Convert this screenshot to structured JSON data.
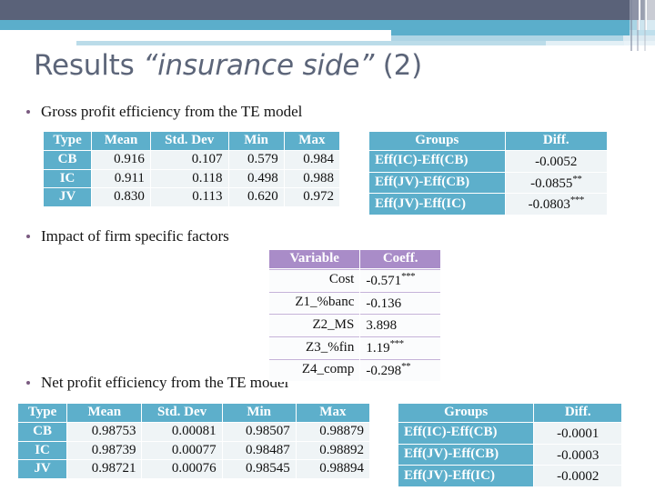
{
  "slide": {
    "title_plain_1": "Results ",
    "title_italic": "“insurance side”",
    "title_plain_2": " (2)",
    "accent_teal": "#5DAFCB",
    "accent_purple": "#A98CC8",
    "title_color": "#5C6579",
    "header_dark": "#5A6279"
  },
  "bullets": {
    "b1": "Gross profit efficiency from the TE model",
    "b2": "Impact of firm specific factors",
    "b3": "Net profit efficiency from the TE model"
  },
  "table_gross_stats": {
    "headers": [
      "Type",
      "Mean",
      "Std. Dev",
      "Min",
      "Max"
    ],
    "rows": [
      {
        "type": "CB",
        "mean": "0.916",
        "sd": "0.107",
        "min": "0.579",
        "max": "0.984"
      },
      {
        "type": "IC",
        "mean": "0.911",
        "sd": "0.118",
        "min": "0.498",
        "max": "0.988"
      },
      {
        "type": "JV",
        "mean": "0.830",
        "sd": "0.113",
        "min": "0.620",
        "max": "0.972"
      }
    ]
  },
  "table_gross_diff": {
    "headers": [
      "Groups",
      "Diff."
    ],
    "rows": [
      {
        "group": "Eff(IC)-Eff(CB)",
        "diff": "-0.0052",
        "stars": ""
      },
      {
        "group": "Eff(JV)-Eff(CB)",
        "diff": "-0.0855",
        "stars": "**"
      },
      {
        "group": "Eff(JV)-Eff(IC)",
        "diff": "-0.0803",
        "stars": "***"
      }
    ]
  },
  "table_factors": {
    "headers": [
      "Variable",
      "Coeff."
    ],
    "rows": [
      {
        "variable": "Cost",
        "coeff": "-0.571",
        "stars": "***"
      },
      {
        "variable": "Z1_%banc",
        "coeff": "-0.136",
        "stars": ""
      },
      {
        "variable": "Z2_MS",
        "coeff": "3.898",
        "stars": ""
      },
      {
        "variable": "Z3_%fin",
        "coeff": "1.19",
        "stars": "***"
      },
      {
        "variable": "Z4_comp",
        "coeff": "-0.298",
        "stars": "**"
      }
    ]
  },
  "table_net_stats": {
    "headers": [
      "Type",
      "Mean",
      "Std. Dev",
      "Min",
      "Max"
    ],
    "rows": [
      {
        "type": "CB",
        "mean": "0.98753",
        "sd": "0.00081",
        "min": "0.98507",
        "max": "0.98879"
      },
      {
        "type": "IC",
        "mean": "0.98739",
        "sd": "0.00077",
        "min": "0.98487",
        "max": "0.98892"
      },
      {
        "type": "JV",
        "mean": "0.98721",
        "sd": "0.00076",
        "min": "0.98545",
        "max": "0.98894"
      }
    ]
  },
  "table_net_diff": {
    "headers": [
      "Groups",
      "Diff."
    ],
    "rows": [
      {
        "group": "Eff(IC)-Eff(CB)",
        "diff": "-0.0001",
        "stars": ""
      },
      {
        "group": "Eff(JV)-Eff(CB)",
        "diff": "-0.0003",
        "stars": ""
      },
      {
        "group": "Eff(JV)-Eff(IC)",
        "diff": "-0.0002",
        "stars": ""
      }
    ]
  }
}
